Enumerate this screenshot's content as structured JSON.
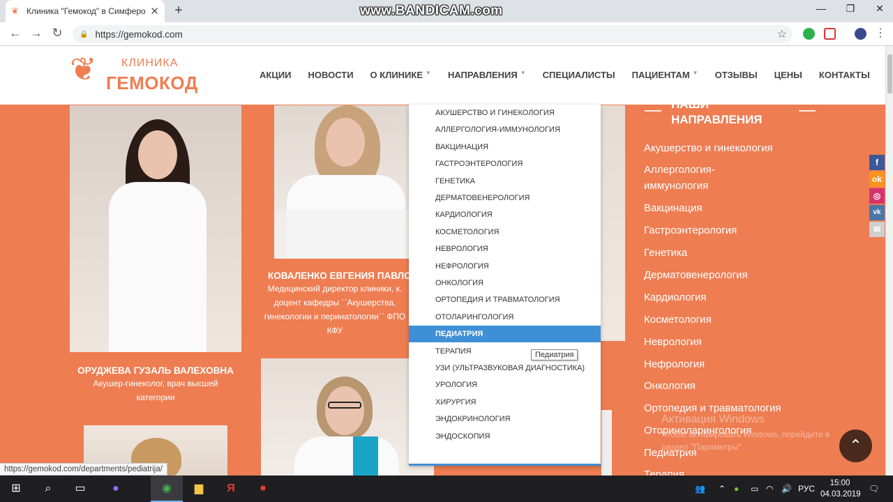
{
  "browser": {
    "tab_title": "Клиника \"Гемокод\" в Симферополе",
    "tab_close": "✕",
    "new_tab": "+",
    "url": "https://gemokod.com",
    "status_url": "https://gemokod.com/departments/pediatrija/",
    "recorder_watermark": "www.BANDICAM.com"
  },
  "site": {
    "logo_top": "КЛИНИКА",
    "logo_main": "ГЕМОКОД",
    "nav": [
      {
        "label": "АКЦИИ",
        "dropdown": false
      },
      {
        "label": "НОВОСТИ",
        "dropdown": false
      },
      {
        "label": "О КЛИНИКЕ",
        "dropdown": true
      },
      {
        "label": "НАПРАВЛЕНИЯ",
        "dropdown": true
      },
      {
        "label": "СПЕЦИАЛИСТЫ",
        "dropdown": false
      },
      {
        "label": "ПАЦИЕНТАМ",
        "dropdown": true
      },
      {
        "label": "ОТЗЫВЫ",
        "dropdown": false
      },
      {
        "label": "ЦЕНЫ",
        "dropdown": false
      },
      {
        "label": "КОНТАКТЫ",
        "dropdown": false
      }
    ],
    "doctors": [
      {
        "name": "ОРУДЖЕВА ГУЗАЛЬ ВАЛЕХОВНА",
        "desc_1": "Акушер-гинеколог, врач высшей",
        "desc_2": "категории"
      },
      {
        "name": "КОВАЛЕНКО ЕВГЕНИЯ ПАВЛОВ",
        "desc_1": "Медицинский директор клиники, к.",
        "desc_2": "доцент кафедры ``Акушерства,",
        "desc_3": "гинекологии и перинатологии`` ФПО",
        "desc_4": "КФУ"
      }
    ],
    "dropdown_items": [
      "Акушерство и гинекология",
      "Аллергология-иммунология",
      "Вакцинация",
      "Гастроэнтерология",
      "Генетика",
      "Дерматовенерология",
      "Кардиология",
      "Косметология",
      "Неврология",
      "Нефрология",
      "Онкология",
      "Ортопедия и травматология",
      "Отоларингология",
      "Педиатрия",
      "Терапия",
      "УЗИ (ультразвуковая диагностика)",
      "Урология",
      "Хирургия",
      "Эндокринология",
      "Эндоскопия"
    ],
    "dropdown_active": "Педиатрия",
    "tooltip": "Педиатрия",
    "panel_title_1": "НАШИ",
    "panel_title_2": "НАПРАВЛЕНИЯ",
    "panel_items": [
      "Акушерство и гинекология",
      "Аллергология-",
      "иммунология",
      "Вакцинация",
      "Гастроэнтерология",
      "Генетика",
      "Дерматовенерология",
      "Кардиология",
      "Косметология",
      "Неврология",
      "Нефрология",
      "Онкология",
      "Ортопедия и травматология",
      "Оториноларингология",
      "Педиатрия",
      "Терапия"
    ],
    "social": [
      {
        "icon": "facebook-icon",
        "glyph": "f",
        "color": "#3b5998"
      },
      {
        "icon": "odnoklassniki-icon",
        "glyph": "ok",
        "color": "#f7931e"
      },
      {
        "icon": "instagram-icon",
        "glyph": "◎",
        "color": "#d6336c"
      },
      {
        "icon": "vk-icon",
        "glyph": "vk",
        "color": "#4a76a8"
      },
      {
        "icon": "email-icon",
        "glyph": "✉",
        "color": "#cfcfcf"
      }
    ],
    "activation_line_1": "Активация Windows",
    "activation_line_2": "Чтобы активировать Windows, перейдите в",
    "activation_line_3": "раздел \"Параметры\"."
  },
  "taskbar": {
    "lang": "РУС",
    "time": "15:00",
    "date": "04.03.2019"
  },
  "colors": {
    "brand": "#ee7d52",
    "dropdown_active": "#3e8fd6"
  }
}
